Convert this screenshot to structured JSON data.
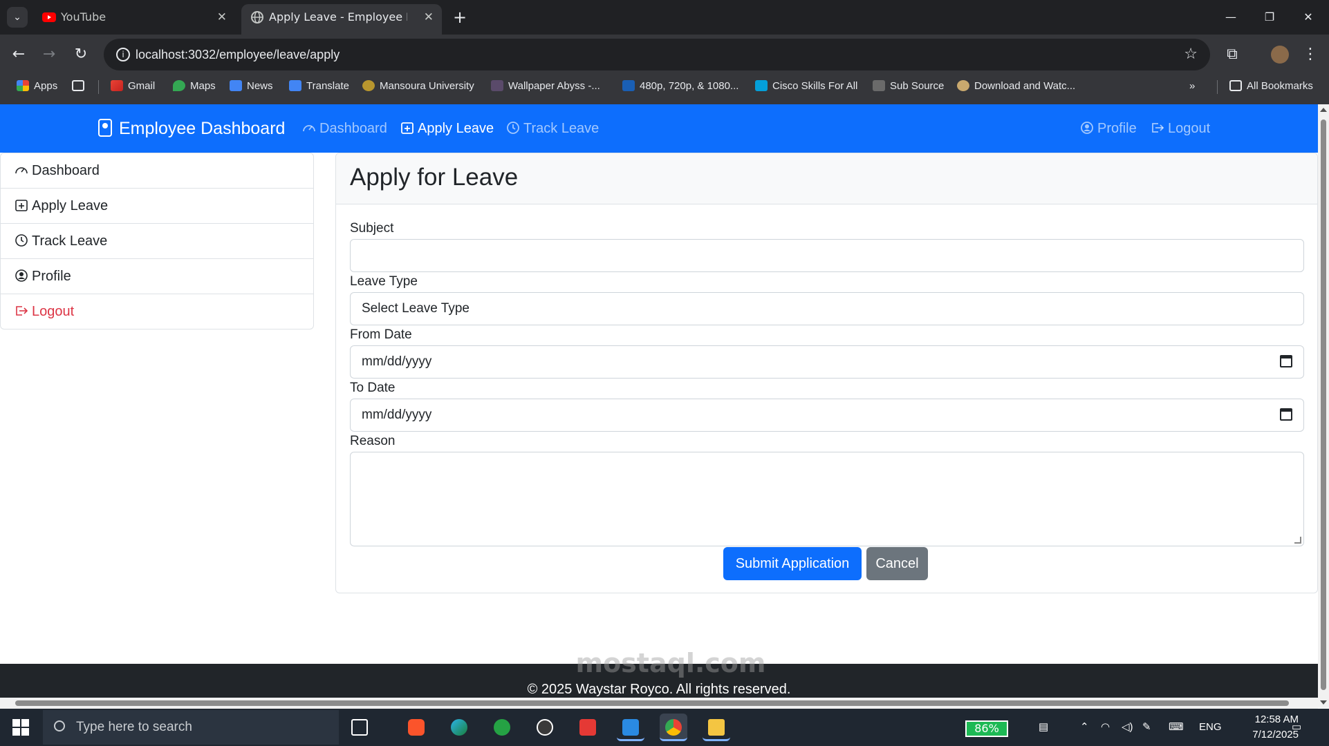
{
  "browser": {
    "tabs": [
      {
        "title": "YouTube",
        "active": false
      },
      {
        "title": "Apply Leave - Employee Dashb",
        "active": true
      }
    ],
    "url": "localhost:3032/employee/leave/apply",
    "bookmarks": [
      "Apps",
      "Gmail",
      "Maps",
      "News",
      "Translate",
      "Mansoura University",
      "Wallpaper Abyss -...",
      "480p, 720p, & 1080...",
      "Cisco Skills For All",
      "Sub Source",
      "Download and Watc...",
      "All Bookmarks"
    ],
    "overflow": "»"
  },
  "app": {
    "brand": "Employee Dashboard",
    "nav": [
      {
        "label": "Dashboard",
        "icon": "speedometer-icon"
      },
      {
        "label": "Apply Leave",
        "icon": "calendar-plus-icon"
      },
      {
        "label": "Track Leave",
        "icon": "clock-icon"
      }
    ],
    "nav_right": [
      {
        "label": "Profile",
        "icon": "person-circle-icon"
      },
      {
        "label": "Logout",
        "icon": "box-arrow-right-icon"
      }
    ],
    "sidebar": [
      {
        "label": "Dashboard",
        "icon": "speedometer-icon"
      },
      {
        "label": "Apply Leave",
        "icon": "calendar-plus-icon"
      },
      {
        "label": "Track Leave",
        "icon": "clock-icon"
      },
      {
        "label": "Profile",
        "icon": "person-circle-icon"
      },
      {
        "label": "Logout",
        "icon": "box-arrow-right-icon"
      }
    ]
  },
  "form": {
    "title": "Apply for Leave",
    "subject_label": "Subject",
    "subject_value": "",
    "leave_type_label": "Leave Type",
    "leave_type_value": "Select Leave Type",
    "from_label": "From Date",
    "from_value": "mm/dd/yyyy",
    "to_label": "To Date",
    "to_value": "mm/dd/yyyy",
    "reason_label": "Reason",
    "submit_label": "Submit Application",
    "cancel_label": "Cancel"
  },
  "footer": {
    "text": "© 2025 Waystar Royco. All rights reserved."
  },
  "taskbar": {
    "search_placeholder": "Type here to search",
    "battery": "86%",
    "language": "ENG",
    "time": "12:58 AM",
    "date": "7/12/2025"
  },
  "watermark": "mostaql.com",
  "colors": {
    "primary": "#0d6efd",
    "secondary": "#6c757d",
    "danger": "#dc3545",
    "footer": "#212529"
  }
}
